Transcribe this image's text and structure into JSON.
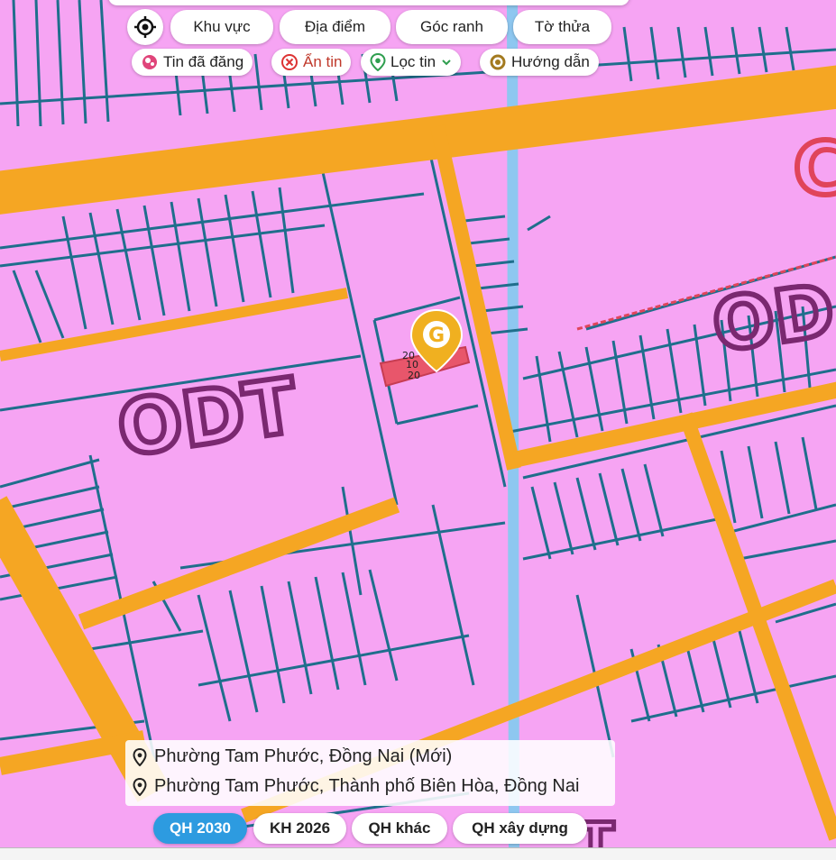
{
  "colors": {
    "land": "#f6a4f3",
    "road": "#f5a623",
    "parcel_line": "#1f6e8c",
    "water": "#8ec7f0",
    "zone_label": "#7a2870",
    "active_layer": "#2d9be0",
    "marker": "#f0b020"
  },
  "toolbar": {
    "locate_icon": "crosshair-icon",
    "tabs": [
      "Khu vực",
      "Địa điểm",
      "Góc ranh",
      "Tờ thửa"
    ]
  },
  "actions": {
    "posted": "Tin đã đăng",
    "hide": "Ẩn tin",
    "filter": "Lọc tin",
    "guide": "Hướng dẫn"
  },
  "map": {
    "zone_labels": [
      "ODT",
      "OD",
      "T"
    ],
    "marker_letter": "G",
    "parcel_labels": [
      "20",
      "10",
      "20"
    ]
  },
  "address": {
    "line1": "Phường Tam Phước, Đồng Nai (Mới)",
    "line2": "Phường Tam Phước, Thành phố Biên Hòa, Đồng Nai"
  },
  "layers": {
    "items": [
      "QH 2030",
      "KH 2026",
      "QH khác",
      "QH xây dựng"
    ],
    "active": "QH 2030"
  }
}
